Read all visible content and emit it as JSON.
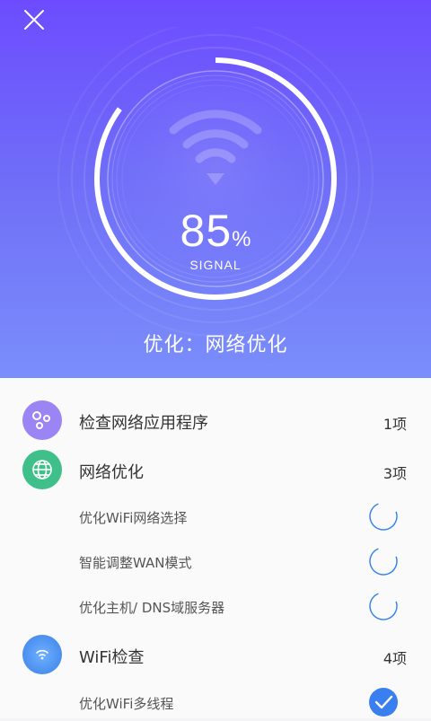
{
  "header": {
    "close_icon": "close-icon",
    "signal_value": "85",
    "signal_unit": "%",
    "signal_label": "SIGNAL",
    "title": "优化：网络优化",
    "background_top": "#6d4cff",
    "background_bottom": "#7a8efa"
  },
  "progress": 0.85,
  "groups": [
    {
      "label": "检查网络应用程序",
      "count": "1项",
      "icon": "apps-icon",
      "icon_color": "#9b84f4",
      "items": []
    },
    {
      "label": "网络优化",
      "count": "3项",
      "icon": "globe-icon",
      "icon_color": "#3fbf8a",
      "items": [
        {
          "label": "优化WiFi网络选择",
          "status": "loading"
        },
        {
          "label": "智能调整WAN模式",
          "status": "loading"
        },
        {
          "label": "优化主机/ DNS域服务器",
          "status": "loading"
        }
      ]
    },
    {
      "label": "WiFi检查",
      "count": "4项",
      "icon": "wifi-icon",
      "icon_color": "#4a8ef0",
      "items": [
        {
          "label": "优化WiFi多线程",
          "status": "done"
        }
      ]
    }
  ]
}
